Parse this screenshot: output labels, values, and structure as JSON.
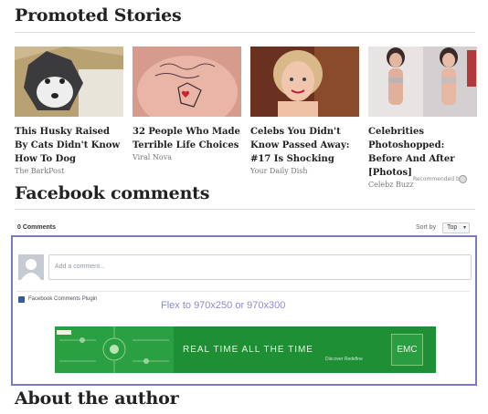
{
  "promoted": {
    "heading": "Promoted Stories",
    "recommended_label": "Recommended by",
    "stories": [
      {
        "title": "This Husky Raised By Cats Didn't Know How To Dog",
        "source": "The BarkPost"
      },
      {
        "title": "32 People Who Made Terrible Life Choices",
        "source": "Viral Nova"
      },
      {
        "title": "Celebs You Didn't Know Passed Away: #17 Is Shocking",
        "source": "Your Daily Dish"
      },
      {
        "title": "Celebrities Photoshopped: Before And After [Photos]",
        "source": "Celebz Buzz"
      }
    ]
  },
  "facebook": {
    "heading": "Facebook comments",
    "count_label": "0 Comments",
    "sort_label": "Sort by",
    "sort_value": "Top",
    "input_placeholder": "Add a comment...",
    "plugin_label": "Facebook Comments Plugin"
  },
  "ad": {
    "flex_text": "Flex to 970x250 or 970x300",
    "tagline": "REAL TIME ALL THE TIME",
    "sub": "Discover Redefine",
    "brand": "EMC"
  },
  "about": {
    "heading": "About the author"
  },
  "colors": {
    "frame": "#7a7ac4",
    "banner": "#1f8f35",
    "flex_text": "#8a8ad6"
  }
}
